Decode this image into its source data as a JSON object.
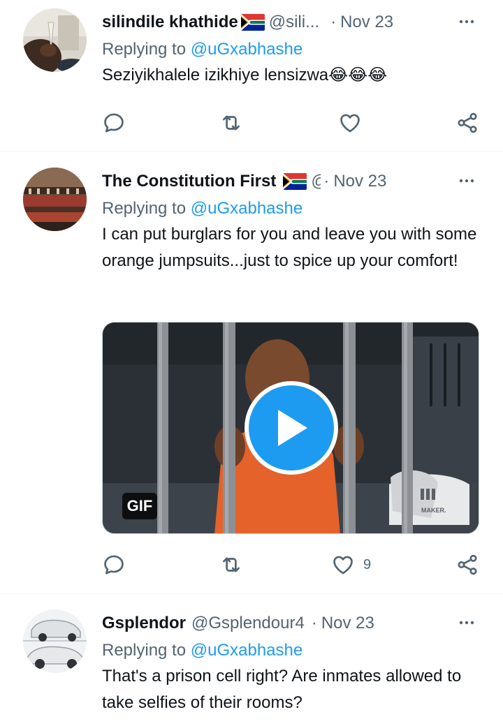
{
  "tweets": [
    {
      "name": "silindile khathide",
      "handle": "@sili...",
      "sep": "·",
      "date": "Nov 23",
      "replying_prefix": "Replying to",
      "replying_to": "@uGxabhashe",
      "text": "Seziyikhalele izikhiye lensizwa😂😂😂",
      "likes": ""
    },
    {
      "name": "The Constitution First",
      "handle": "@",
      "sep": "·",
      "date": "Nov 23",
      "replying_prefix": "Replying to",
      "replying_to": "@uGxabhashe",
      "text": "I can put burglars for you and leave you with some orange jumpsuits...just to spice up your comfort!",
      "media": {
        "badge": "GIF",
        "watermark": "MAKER."
      },
      "likes": "9"
    },
    {
      "name": "Gsplendor",
      "handle": "@Gsplendour4",
      "sep": "·",
      "date": "Nov 23",
      "replying_prefix": "Replying to",
      "replying_to": "@uGxabhashe",
      "text": "That's a prison cell right? Are inmates allowed to take selfies of their rooms?",
      "likes": ""
    }
  ],
  "icons": {
    "reply": "reply-icon",
    "retweet": "retweet-icon",
    "like": "heart-icon",
    "share": "share-icon",
    "more": "more-icon",
    "play": "play-icon",
    "flag": "south-africa-flag-icon"
  },
  "colors": {
    "link": "#1d9bf0",
    "secondary": "#536471",
    "text": "#0f1419"
  }
}
